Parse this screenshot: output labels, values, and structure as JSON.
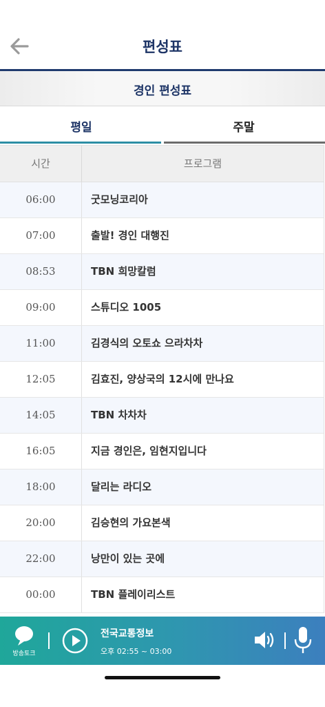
{
  "header": {
    "title": "편성표",
    "back_icon": "arrow-left-icon"
  },
  "subheader": {
    "title": "경인 편성표"
  },
  "tabs": [
    {
      "label": "평일",
      "active": true
    },
    {
      "label": "주말",
      "active": false
    }
  ],
  "table": {
    "headers": {
      "time": "시간",
      "program": "프로그램"
    },
    "rows": [
      {
        "time": "06:00",
        "program": "굿모닝코리아"
      },
      {
        "time": "07:00",
        "program": "출발! 경인 대행진"
      },
      {
        "time": "08:53",
        "program": "TBN 희망칼럼"
      },
      {
        "time": "09:00",
        "program": "스튜디오 1005"
      },
      {
        "time": "11:00",
        "program": "김경식의 오토쇼 으라차차"
      },
      {
        "time": "12:05",
        "program": "김효진, 양상국의 12시에 만나요"
      },
      {
        "time": "14:05",
        "program": "TBN 차차차"
      },
      {
        "time": "16:05",
        "program": "지금 경인은, 임현지입니다"
      },
      {
        "time": "18:00",
        "program": "달리는 라디오"
      },
      {
        "time": "20:00",
        "program": "김승현의 가요본색"
      },
      {
        "time": "22:00",
        "program": "낭만이 있는 곳에"
      },
      {
        "time": "00:00",
        "program": "TBN 플레이리스트"
      }
    ]
  },
  "player": {
    "talk_label": "방송토크",
    "now_title": "전국교통정보",
    "now_time": "오후 02:55 ~ 03:00",
    "icons": [
      "chat-bubble-icon",
      "play-icon",
      "speaker-icon",
      "microphone-icon"
    ]
  },
  "colors": {
    "navy": "#1d3466",
    "teal": "#2c8ea5",
    "player_start": "#1fa79a",
    "player_end": "#3c7fbe"
  }
}
